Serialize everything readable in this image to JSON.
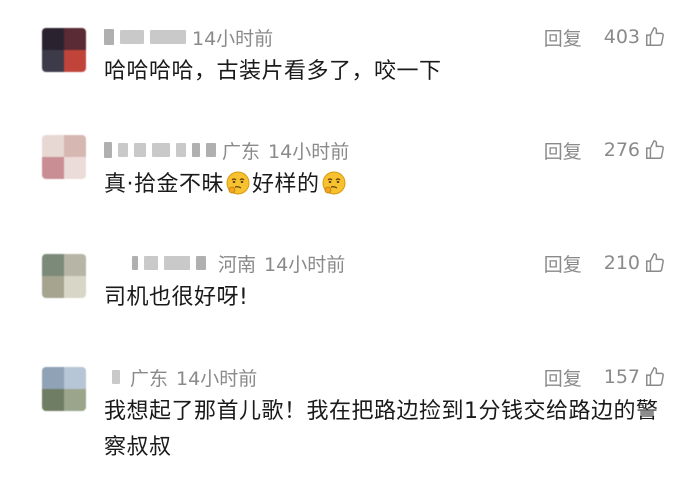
{
  "comments": [
    {
      "time": "14小时前",
      "region": "",
      "reply_label": "回复",
      "likes": "403",
      "text": "哈哈哈哈，古装片看多了，咬一下"
    },
    {
      "time": "14小时前",
      "region": "广东",
      "reply_label": "回复",
      "likes": "276",
      "text_before": "真·拾金不昧",
      "text_middle": "好样的"
    },
    {
      "time": "14小时前",
      "region": "河南",
      "reply_label": "回复",
      "likes": "210",
      "text": "司机也很好呀!"
    },
    {
      "time": "14小时前",
      "region": "广东",
      "reply_label": "回复",
      "likes": "157",
      "text": "我想起了那首儿歌！我在把路边捡到1分钱交给路边的警察叔叔"
    }
  ],
  "icons": {
    "like": "thumbs-up-icon",
    "emoji": "thinking-face-emoji"
  }
}
